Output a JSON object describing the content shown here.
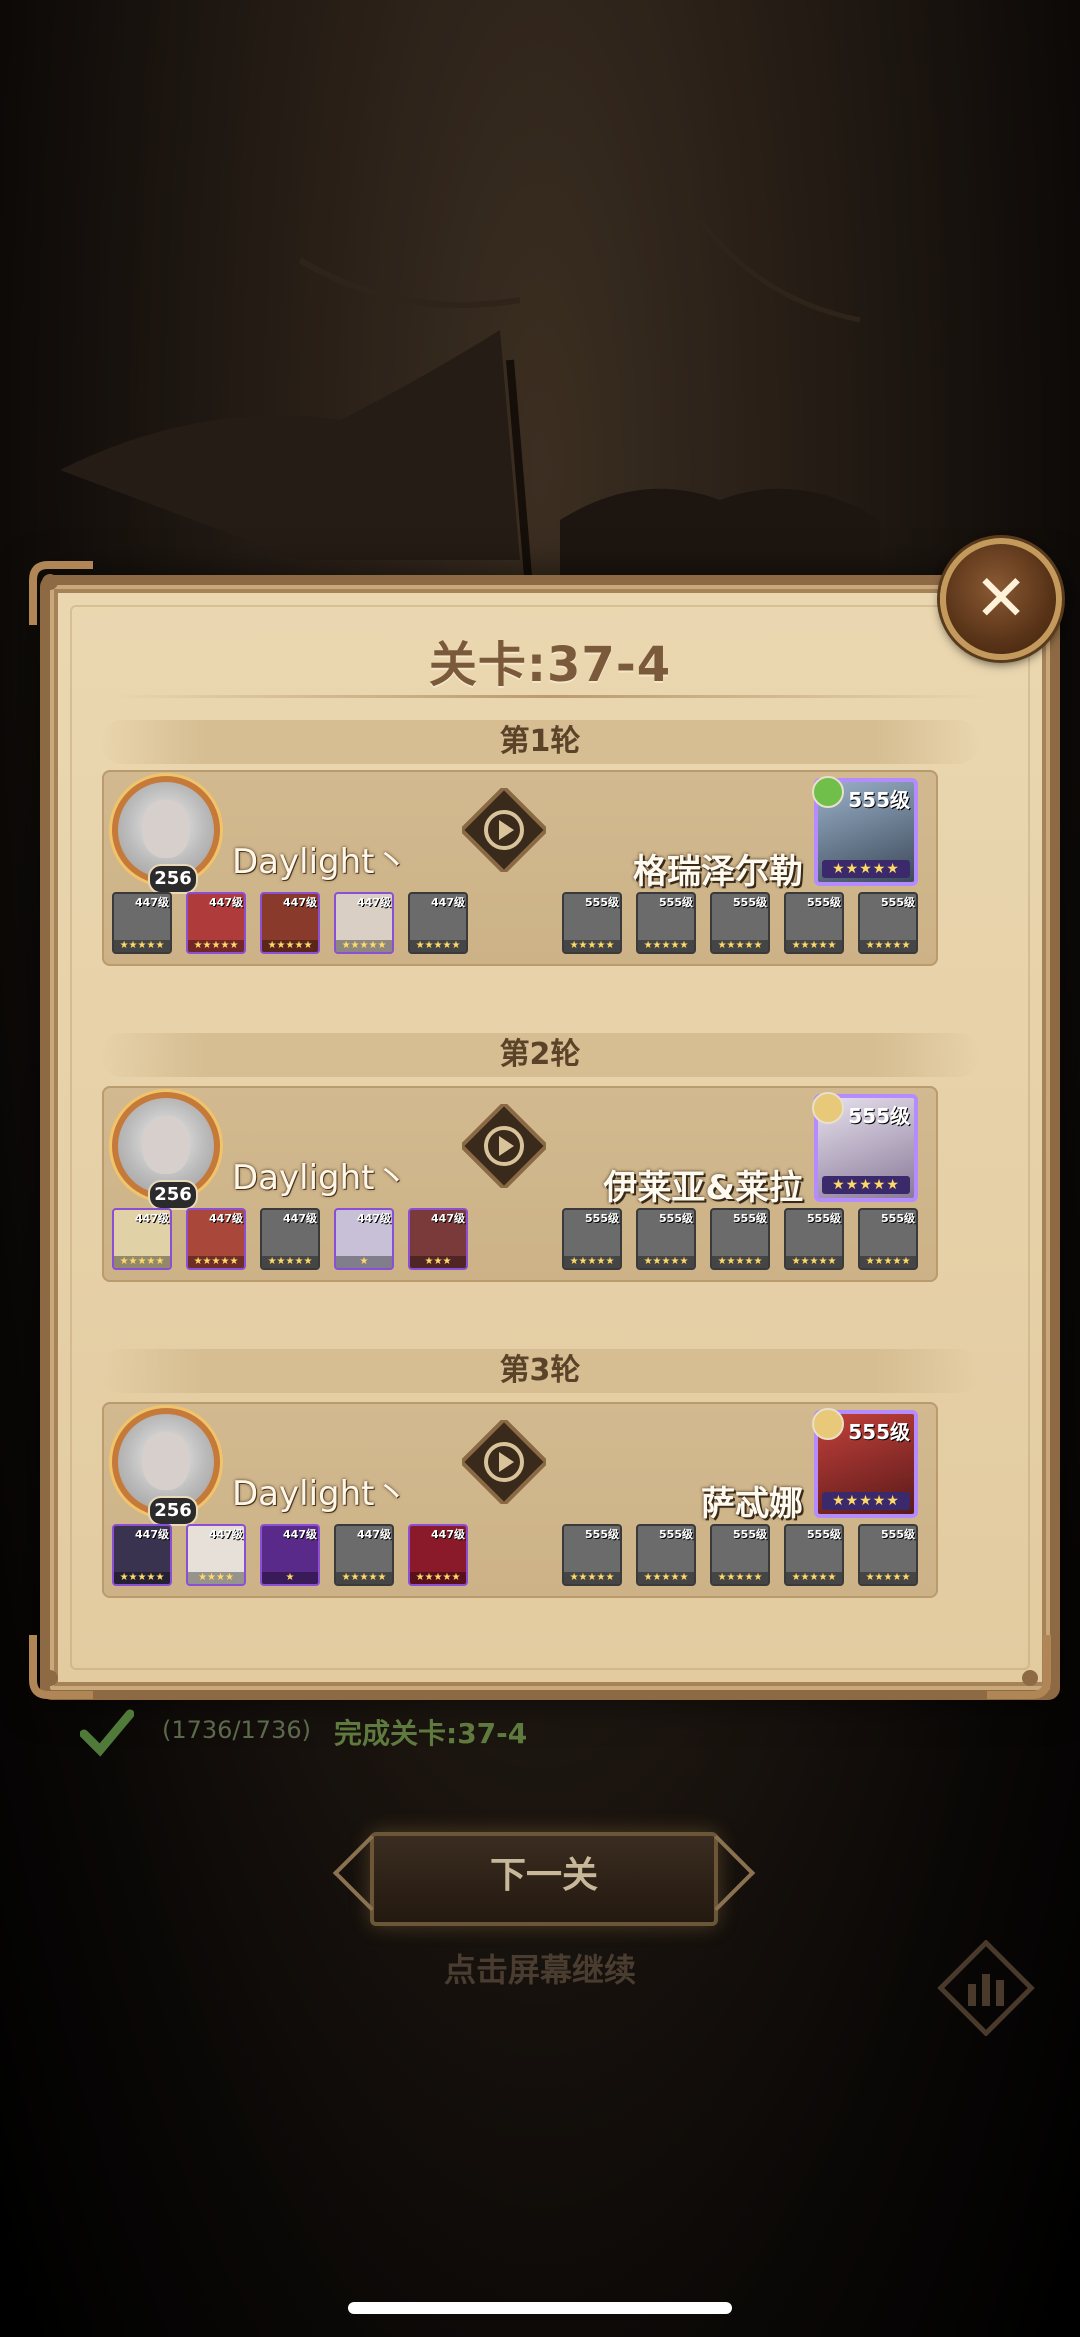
{
  "stage": {
    "title": "关卡:37-4"
  },
  "rounds": [
    {
      "label": "第1轮",
      "player": {
        "name": "Daylight丶",
        "level": "256"
      },
      "enemy": {
        "name": "格瑞泽尔勒",
        "level": "555级",
        "stars": "★★★★★"
      },
      "player_heroes": [
        {
          "level": "447级",
          "stars": "★★★★★",
          "color": false
        },
        {
          "level": "447级",
          "stars": "★★★★★",
          "color": true
        },
        {
          "level": "447级",
          "stars": "★★★★★",
          "color": true
        },
        {
          "level": "447级",
          "stars": "★★★★★",
          "color": true
        },
        {
          "level": "447级",
          "stars": "★★★★★",
          "color": false
        }
      ],
      "enemy_heroes": [
        {
          "level": "555级",
          "stars": "★★★★★"
        },
        {
          "level": "555级",
          "stars": "★★★★★"
        },
        {
          "level": "555级",
          "stars": "★★★★★"
        },
        {
          "level": "555级",
          "stars": "★★★★★"
        },
        {
          "level": "555级",
          "stars": "★★★★★"
        }
      ]
    },
    {
      "label": "第2轮",
      "player": {
        "name": "Daylight丶",
        "level": "256"
      },
      "enemy": {
        "name": "伊莱亚&莱拉",
        "level": "555级",
        "stars": "★★★★★"
      },
      "player_heroes": [
        {
          "level": "447级",
          "stars": "★★★★★",
          "color": true
        },
        {
          "level": "447级",
          "stars": "★★★★★",
          "color": true
        },
        {
          "level": "447级",
          "stars": "★★★★★",
          "color": false
        },
        {
          "level": "447级",
          "stars": "★",
          "color": true
        },
        {
          "level": "447级",
          "stars": "★★★",
          "color": true
        }
      ],
      "enemy_heroes": [
        {
          "level": "555级",
          "stars": "★★★★★"
        },
        {
          "level": "555级",
          "stars": "★★★★★"
        },
        {
          "level": "555级",
          "stars": "★★★★★"
        },
        {
          "level": "555级",
          "stars": "★★★★★"
        },
        {
          "level": "555级",
          "stars": "★★★★★"
        }
      ]
    },
    {
      "label": "第3轮",
      "player": {
        "name": "Daylight丶",
        "level": "256"
      },
      "enemy": {
        "name": "萨忒娜",
        "level": "555级",
        "stars": "★★★★★"
      },
      "player_heroes": [
        {
          "level": "447级",
          "stars": "★★★★★",
          "color": true
        },
        {
          "level": "447级",
          "stars": "★★★★",
          "color": true
        },
        {
          "level": "447级",
          "stars": "★",
          "color": true
        },
        {
          "level": "447级",
          "stars": "★★★★★",
          "color": false
        },
        {
          "level": "447级",
          "stars": "★★★★★",
          "color": true
        }
      ],
      "enemy_heroes": [
        {
          "level": "555级",
          "stars": "★★★★★"
        },
        {
          "level": "555级",
          "stars": "★★★★★"
        },
        {
          "level": "555级",
          "stars": "★★★★★"
        },
        {
          "level": "555级",
          "stars": "★★★★★"
        },
        {
          "level": "555级",
          "stars": "★★★★★"
        }
      ]
    }
  ],
  "result": {
    "progress": "(1736/1736)",
    "complete_text": "完成关卡:37-4"
  },
  "actions": {
    "next_button": "下一关",
    "tap_hint": "点击屏幕继续"
  },
  "icons": {
    "close": "close-icon",
    "play": "play-icon",
    "check": "check-icon",
    "stats": "stats-icon"
  }
}
